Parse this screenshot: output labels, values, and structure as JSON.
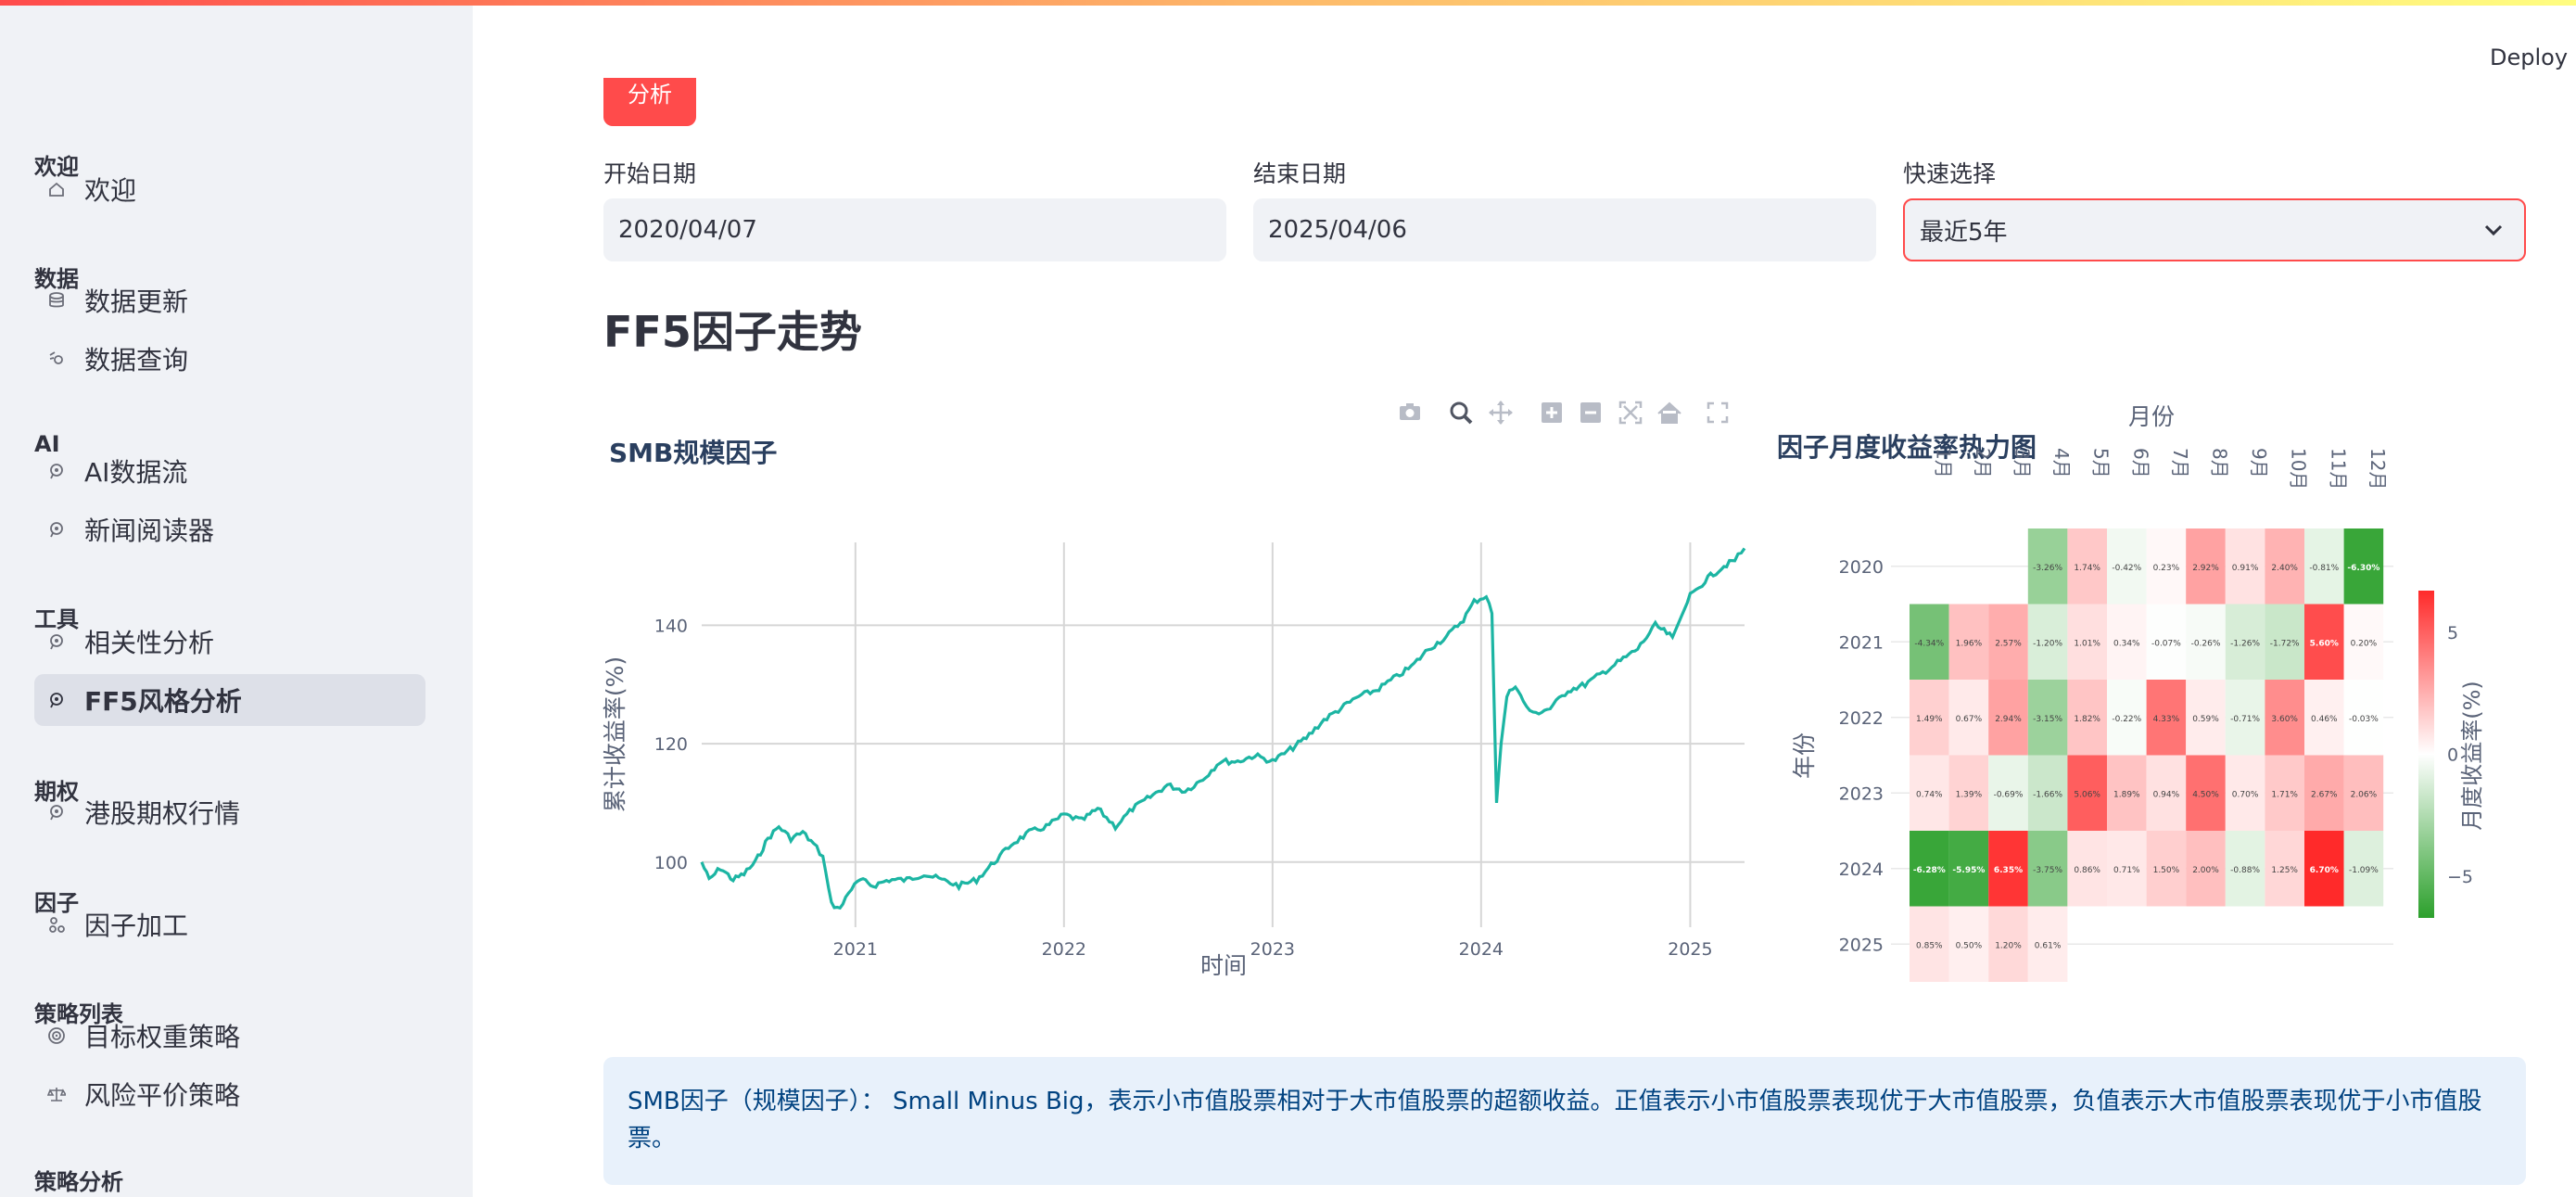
{
  "app": {
    "deploy_label": "Deploy",
    "accent": "#ff4b4b"
  },
  "sidebar": {
    "sections": [
      {
        "title": "欢迎",
        "items": [
          {
            "label": "欢迎",
            "icon": "home-icon"
          }
        ]
      },
      {
        "title": "数据",
        "items": [
          {
            "label": "数据更新",
            "icon": "database-icon"
          },
          {
            "label": "数据查询",
            "icon": "query-icon"
          }
        ]
      },
      {
        "title": "AI",
        "items": [
          {
            "label": "AI数据流",
            "icon": "pin-icon"
          },
          {
            "label": "新闻阅读器",
            "icon": "pin-icon"
          }
        ]
      },
      {
        "title": "工具",
        "items": [
          {
            "label": "相关性分析",
            "icon": "pin-icon"
          },
          {
            "label": "FF5风格分析",
            "icon": "pin-icon",
            "active": true
          }
        ]
      },
      {
        "title": "期权",
        "items": [
          {
            "label": "港股期权行情",
            "icon": "pin-icon"
          }
        ]
      },
      {
        "title": "因子",
        "items": [
          {
            "label": "因子加工",
            "icon": "factor-icon"
          }
        ]
      },
      {
        "title": "策略列表",
        "items": [
          {
            "label": "目标权重策略",
            "icon": "target-icon"
          },
          {
            "label": "风险平价策略",
            "icon": "scale-icon"
          }
        ]
      },
      {
        "title": "策略分析",
        "items": []
      }
    ]
  },
  "main": {
    "top_button_label": "分析",
    "start_date": {
      "label": "开始日期",
      "value": "2020/04/07"
    },
    "end_date": {
      "label": "结束日期",
      "value": "2025/04/06"
    },
    "quick_select": {
      "label": "快速选择",
      "value": "最近5年"
    },
    "section_title": "FF5因子走势",
    "info_text": "SMB因子（规模因子）： Small Minus Big，表示小市值股票相对于大市值股票的超额收益。正值表示小市值股票表现优于大市值股票，负值表示大市值股票表现优于小市值股票。"
  },
  "toolbar_icons": [
    "camera-icon",
    "zoom-icon",
    "pan-icon",
    "zoom-in-icon",
    "zoom-out-icon",
    "autoscale-icon",
    "reset-axes-icon",
    "fullscreen-icon"
  ],
  "chart_data": [
    {
      "type": "line",
      "title": "SMB规模因子",
      "xlabel": "时间",
      "ylabel": "累计收益率(%)",
      "x_ticks": [
        "2021",
        "2022",
        "2023",
        "2024",
        "2025"
      ],
      "y_ticks": [
        100,
        120,
        140
      ],
      "ylim": [
        89,
        154
      ],
      "xlim": [
        "2020-04-07",
        "2025-04-06"
      ],
      "color": "#1cb5a3",
      "grid": true,
      "series": [
        {
          "x": [
            "2020-04-07",
            "2020-04-20",
            "2020-05-10",
            "2020-06-01",
            "2020-06-20",
            "2020-07-10",
            "2020-08-01",
            "2020-08-20",
            "2020-09-10",
            "2020-10-01",
            "2020-10-20",
            "2020-11-05",
            "2020-11-20",
            "2020-12-05",
            "2020-12-20",
            "2021-01-10",
            "2021-02-01",
            "2021-03-01",
            "2021-04-01",
            "2021-05-01",
            "2021-06-01",
            "2021-07-01",
            "2021-08-01",
            "2021-09-01",
            "2021-10-01",
            "2021-11-01",
            "2021-12-01",
            "2022-01-01",
            "2022-02-01",
            "2022-03-01",
            "2022-04-01",
            "2022-05-01",
            "2022-06-01",
            "2022-07-01",
            "2022-08-01",
            "2022-09-01",
            "2022-10-01",
            "2022-11-01",
            "2022-12-01",
            "2023-01-01",
            "2023-02-01",
            "2023-03-01",
            "2023-04-01",
            "2023-05-01",
            "2023-06-01",
            "2023-07-01",
            "2023-08-01",
            "2023-09-01",
            "2023-10-01",
            "2023-11-01",
            "2023-12-01",
            "2023-12-20",
            "2024-01-10",
            "2024-01-20",
            "2024-01-28",
            "2024-02-05",
            "2024-02-15",
            "2024-03-01",
            "2024-03-15",
            "2024-04-01",
            "2024-05-01",
            "2024-06-01",
            "2024-07-01",
            "2024-08-01",
            "2024-09-01",
            "2024-10-01",
            "2024-11-01",
            "2024-12-01",
            "2025-01-01",
            "2025-02-01",
            "2025-03-01",
            "2025-03-20",
            "2025-04-06"
          ],
          "y": [
            100,
            97,
            99,
            97,
            98,
            100,
            104,
            106,
            104,
            105,
            103,
            101,
            93,
            92,
            95,
            97,
            96,
            97,
            97,
            98,
            97,
            96,
            97,
            100,
            103,
            105,
            106,
            108,
            107,
            109,
            106,
            109,
            111,
            113,
            112,
            114,
            117,
            117,
            118,
            117,
            119,
            121,
            124,
            126,
            128,
            129,
            131,
            133,
            136,
            138,
            141,
            144,
            145,
            142,
            110,
            120,
            128,
            130,
            127,
            125,
            126,
            129,
            130,
            132,
            134,
            136,
            140,
            138,
            145,
            148,
            150,
            151,
            153
          ]
        }
      ]
    },
    {
      "type": "heatmap",
      "title": "因子月度收益率热力图",
      "xlabel": "月份",
      "ylabel": "年份",
      "colorbar_label": "月度收益率(%)",
      "colorbar_ticks": [
        5,
        0,
        -5
      ],
      "colorscale": [
        "#2ca02c",
        "#ffffff",
        "#ff2a2a"
      ],
      "zlim": [
        -6.7,
        6.7
      ],
      "x": [
        "1月",
        "2月",
        "3月",
        "4月",
        "5月",
        "6月",
        "7月",
        "8月",
        "9月",
        "10月",
        "11月",
        "12月"
      ],
      "y": [
        "2020",
        "2021",
        "2022",
        "2023",
        "2024",
        "2025"
      ],
      "z": [
        [
          null,
          null,
          null,
          -3.26,
          1.74,
          -0.42,
          0.23,
          2.92,
          0.91,
          2.4,
          -0.81,
          -6.3
        ],
        [
          -4.34,
          1.96,
          2.57,
          -1.2,
          1.01,
          0.34,
          -0.07,
          -0.26,
          -1.26,
          -1.72,
          5.6,
          0.2
        ],
        [
          1.49,
          0.67,
          2.94,
          -3.15,
          1.82,
          -0.22,
          4.33,
          0.59,
          -0.71,
          3.6,
          0.46,
          -0.03
        ],
        [
          0.74,
          1.39,
          -0.69,
          -1.66,
          5.06,
          1.89,
          0.94,
          4.5,
          0.7,
          1.71,
          2.67,
          2.06
        ],
        [
          -6.28,
          -5.95,
          6.35,
          -3.75,
          0.86,
          0.71,
          1.5,
          2.0,
          -0.88,
          1.25,
          6.7,
          -1.09
        ],
        [
          0.85,
          0.5,
          1.2,
          0.61,
          null,
          null,
          null,
          null,
          null,
          null,
          null,
          null
        ]
      ]
    }
  ]
}
